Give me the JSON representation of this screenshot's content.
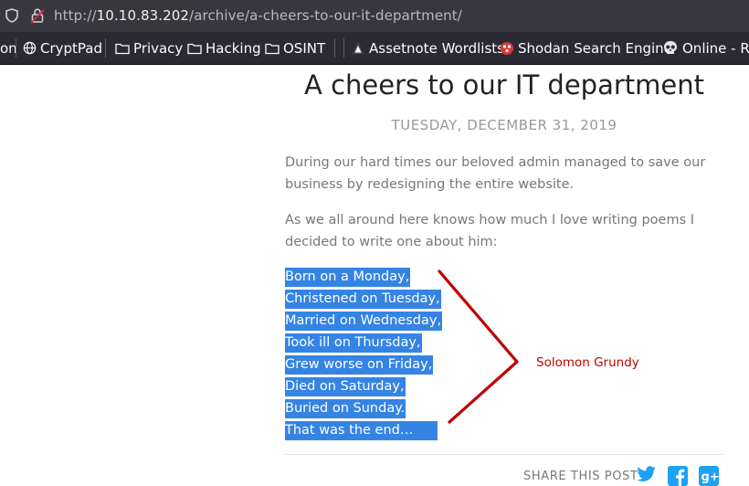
{
  "browser": {
    "url_prefix": "http://",
    "url_host": "10.10.83.202",
    "url_path": "/archive/a-cheers-to-our-it-department/"
  },
  "bookmarks": [
    {
      "label": "on",
      "icon": "extension-icon"
    },
    {
      "label": "CryptPad",
      "icon": "globe-icon"
    },
    {
      "label": "Privacy",
      "icon": "folder-icon"
    },
    {
      "label": "Hacking",
      "icon": "folder-icon"
    },
    {
      "label": "OSINT",
      "icon": "folder-icon"
    },
    {
      "label": "Assetnote Wordlists",
      "icon": "assetnote-icon"
    },
    {
      "label": "Shodan Search Engine",
      "icon": "shodan-icon"
    },
    {
      "label": "Online - Re",
      "icon": "skull-icon"
    }
  ],
  "post": {
    "title": "A cheers to our IT department",
    "date": "TUESDAY, DECEMBER 31, 2019",
    "paragraph_1": "During our hard times our beloved admin managed to save our business by redesigning the entire website.",
    "paragraph_2": "As we all around here knows how much I love writing poems I decided to write one about him:",
    "poem": [
      "Born on a Monday,",
      "Christened on Tuesday,",
      "Married on Wednesday,",
      "Took ill on Thursday,",
      "Grew worse on Friday,",
      "Died on Saturday,",
      "Buried on Sunday.",
      "That was the end…"
    ],
    "annotation": "Solomon Grundy",
    "share_label": "SHARE THIS POST"
  },
  "colors": {
    "selection": "#3584e4",
    "annotation": "#c00000",
    "social_blue": "#1da1f2"
  }
}
